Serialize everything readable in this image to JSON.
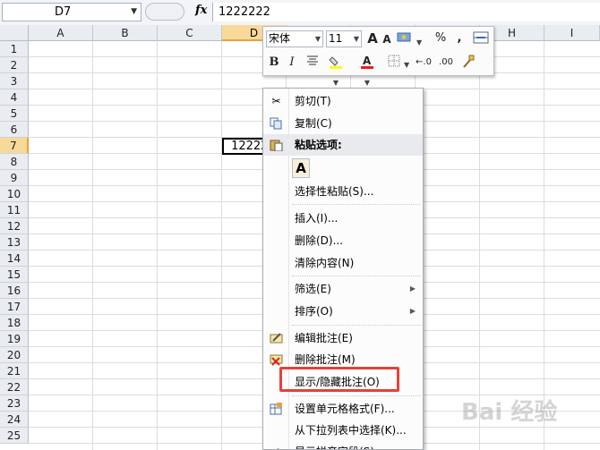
{
  "name_box": {
    "value": "D7"
  },
  "formula_bar": {
    "fx": "fx",
    "value": "1222222"
  },
  "columns": [
    "A",
    "B",
    "C",
    "D",
    "",
    "",
    "",
    "H",
    "I"
  ],
  "rows": [
    "1",
    "2",
    "3",
    "4",
    "5",
    "6",
    "7",
    "8",
    "9",
    "10",
    "11",
    "12",
    "13",
    "14",
    "15",
    "16",
    "17",
    "18",
    "19",
    "20",
    "21",
    "22",
    "23",
    "24",
    "25"
  ],
  "active_cell": {
    "value": "1222222"
  },
  "mini_toolbar": {
    "font": "宋体",
    "size": "11",
    "grow": "A",
    "shrink": "A",
    "percent": "%",
    "comma": ",",
    "bold": "B",
    "italic": "I",
    "inc_dec": "←.0",
    "dec_dec": ".00"
  },
  "context_menu": {
    "cut": "剪切(T)",
    "copy": "复制(C)",
    "paste_options": "粘贴选项:",
    "paste_icon": "A",
    "paste_special": "选择性粘贴(S)...",
    "insert": "插入(I)...",
    "delete": "删除(D)...",
    "clear": "清除内容(N)",
    "filter": "筛选(E)",
    "sort": "排序(O)",
    "edit_comment": "编辑批注(E)",
    "delete_comment": "删除批注(M)",
    "show_hide_comment": "显示/隐藏批注(O)",
    "format_cells": "设置单元格格式(F)...",
    "pick_list": "从下拉列表中选择(K)...",
    "phonetic": "显示拼音字段(S)"
  },
  "watermark": "Bai 经验",
  "colors": {
    "highlight": "#e5403b",
    "active_header": "#f9d99a"
  }
}
